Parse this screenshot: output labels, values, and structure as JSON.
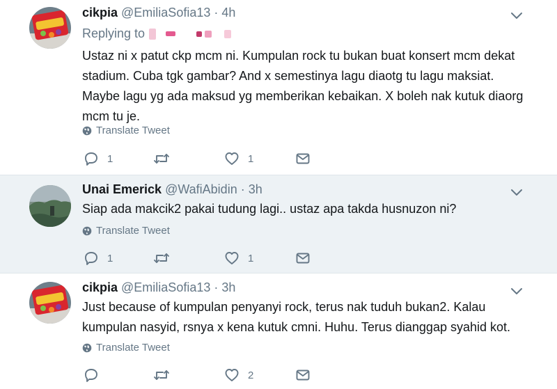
{
  "tweets": [
    {
      "name": "cikpia",
      "handle": "@EmiliaSofia13",
      "sep": "·",
      "time": "4h",
      "replying_label": "Replying to",
      "lines": [
        "Ustaz ni x patut ckp mcm ni. Kumpulan rock tu bukan buat konsert mcm dekat",
        "stadium. Cuba tgk gambar? And x semestinya lagu diaotg tu lagu maksiat.",
        "Maybe lagu yg ada maksud yg memberikan kebaikan. X boleh nak kutuk diaorg",
        "mcm tu je."
      ],
      "translate": "Translate Tweet",
      "replies": "1",
      "retweets": "",
      "likes": "1"
    },
    {
      "name": "Unai Emerick",
      "handle": "@WafiAbidin",
      "sep": "·",
      "time": "3h",
      "lines": [
        "Siap ada makcik2 pakai tudung lagi.. ustaz apa takda husnuzon ni?"
      ],
      "translate": "Translate Tweet",
      "replies": "1",
      "retweets": "",
      "likes": "1"
    },
    {
      "name": "cikpia",
      "handle": "@EmiliaSofia13",
      "sep": "·",
      "time": "3h",
      "lines": [
        "Just because of kumpulan penyanyi rock, terus nak tuduh bukan2. Kalau",
        "kumpulan nasyid, rsnya x kena kutuk cmni. Huhu. Terus dianggap syahid kot."
      ],
      "translate": "Translate Tweet",
      "replies": "",
      "retweets": "",
      "likes": "2"
    }
  ],
  "colors": {
    "thread_line": "#f0b7cd",
    "highlight_bg": "#edf2f5",
    "secondary_text": "#657786",
    "icon": "#657786"
  },
  "icons": [
    "chevron-down-icon",
    "globe-icon",
    "reply-icon",
    "retweet-icon",
    "heart-icon",
    "dm-icon"
  ]
}
